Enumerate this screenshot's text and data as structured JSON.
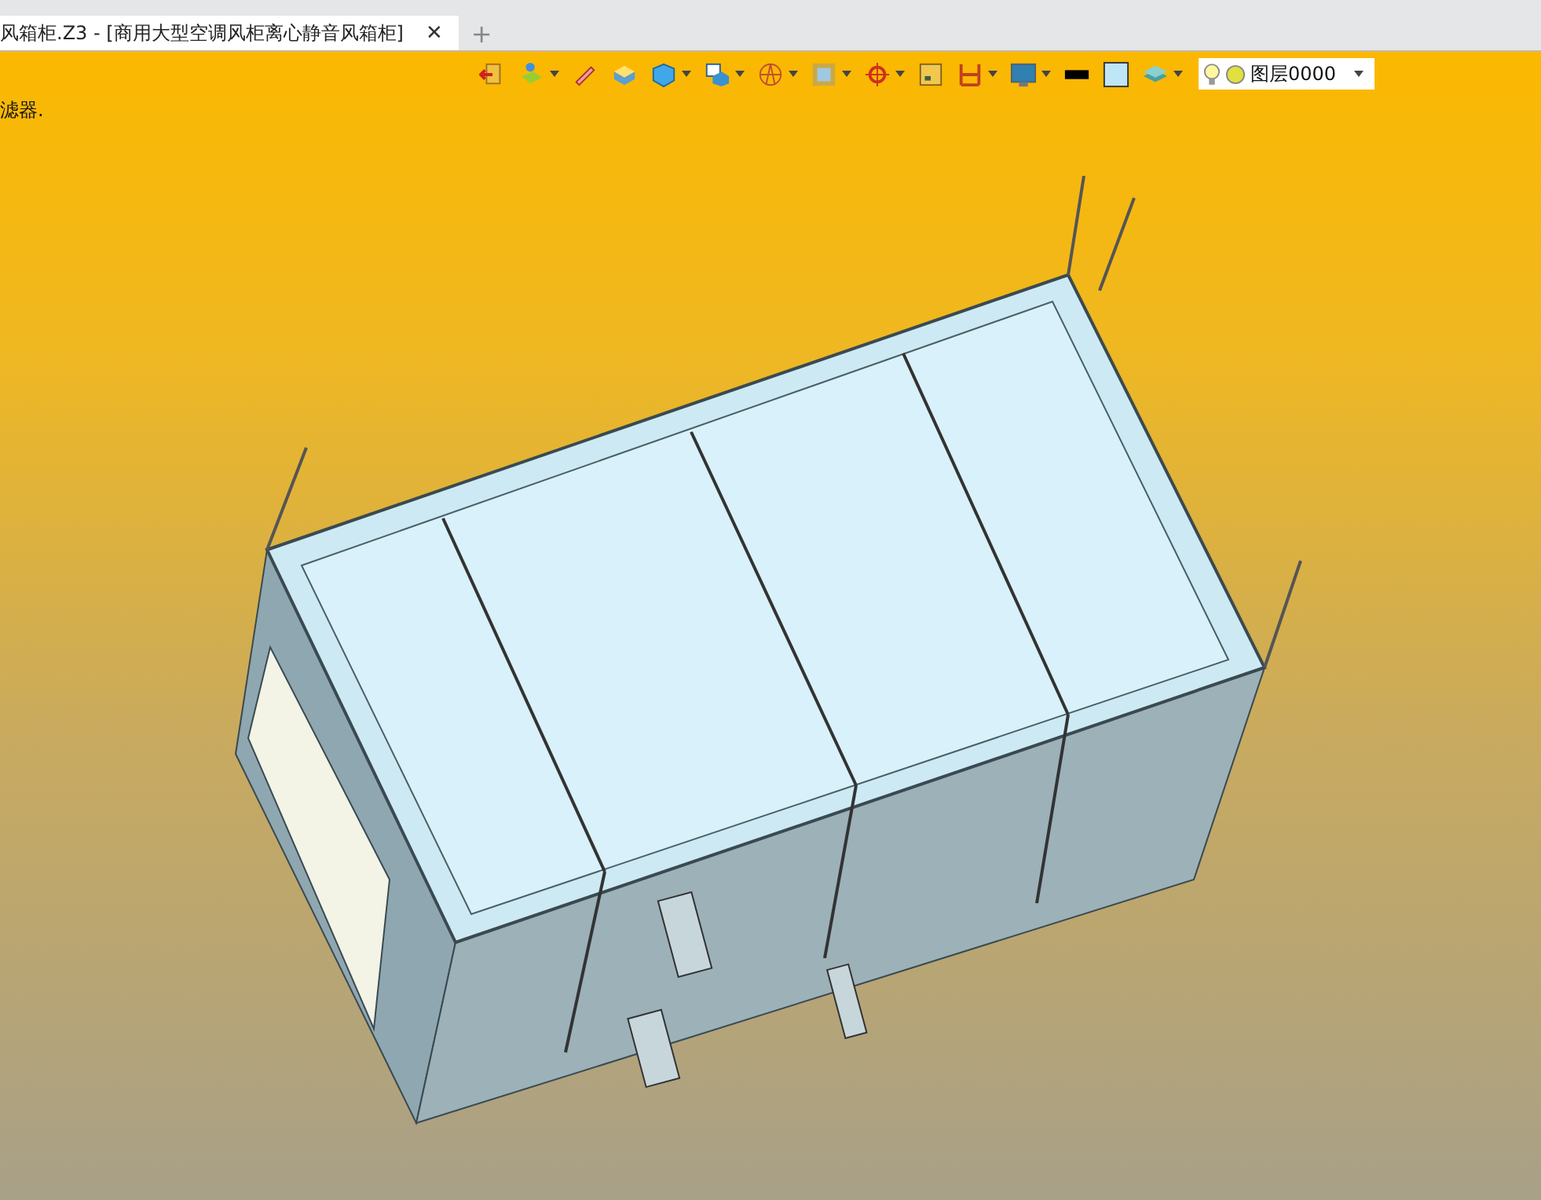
{
  "document_tab": {
    "title": "风箱柜.Z3 - [商用大型空调风柜离心静音风箱柜]",
    "close": "✕",
    "selected": true
  },
  "new_tab": "+",
  "prompt": "滤器.",
  "toolbar": [
    {
      "kind": "exit",
      "dropdown": false
    },
    {
      "kind": "sketch",
      "dropdown": true
    },
    {
      "kind": "pencil",
      "dropdown": false
    },
    {
      "kind": "block",
      "dropdown": false
    },
    {
      "kind": "cube",
      "dropdown": true
    },
    {
      "kind": "view",
      "dropdown": true
    },
    {
      "kind": "wire",
      "dropdown": true
    },
    {
      "kind": "frame",
      "dropdown": true
    },
    {
      "kind": "target",
      "dropdown": true
    },
    {
      "kind": "note",
      "dropdown": false
    },
    {
      "kind": "measure",
      "dropdown": true
    },
    {
      "kind": "monitor",
      "dropdown": true
    },
    {
      "kind": "line",
      "dropdown": false
    },
    {
      "kind": "fill",
      "dropdown": false
    },
    {
      "kind": "layers",
      "dropdown": true
    }
  ],
  "layer": {
    "value": "图层0000",
    "visible": true
  }
}
